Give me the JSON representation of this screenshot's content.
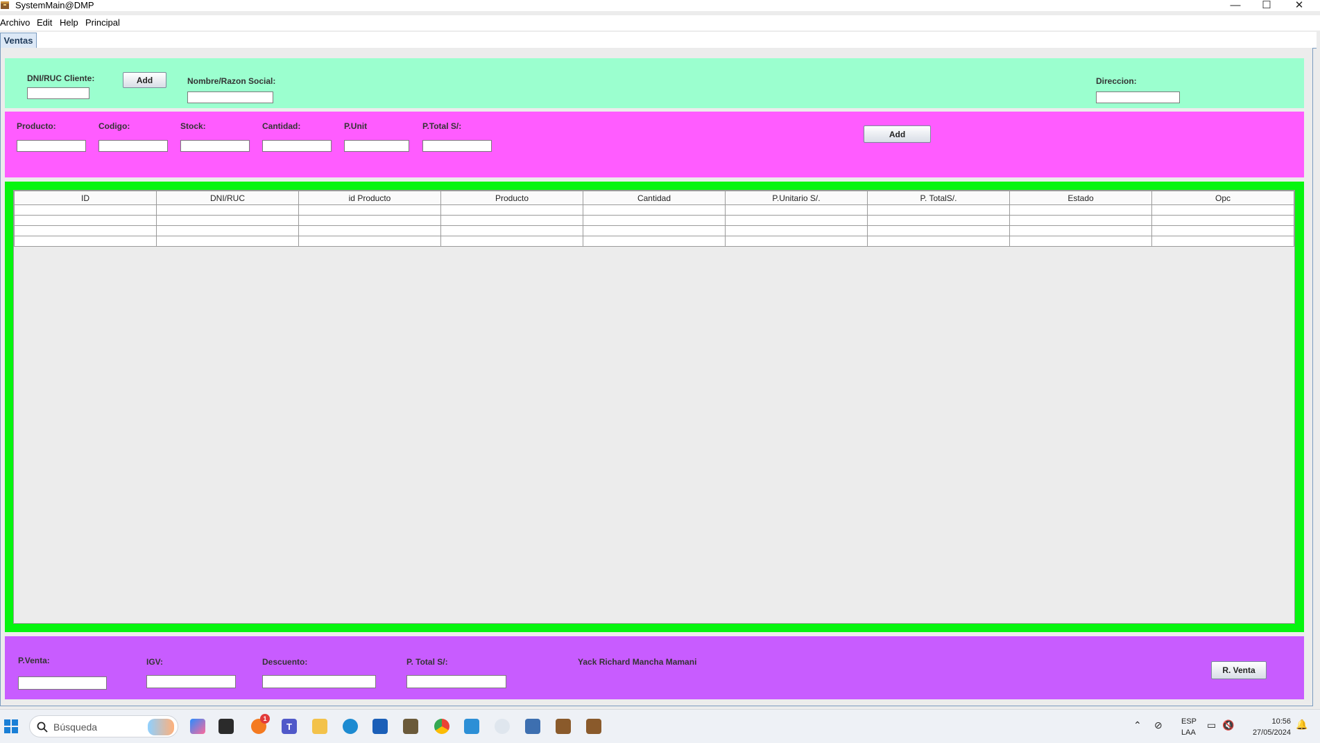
{
  "window": {
    "title": "SystemMain@DMP",
    "minimize_glyph": "—",
    "maximize_glyph": "☐",
    "close_glyph": "✕"
  },
  "menu": {
    "items": [
      "Archivo",
      "Edit",
      "Help",
      "Principal"
    ]
  },
  "tabs": [
    {
      "label": "Ventas",
      "selected": true
    }
  ],
  "client_panel": {
    "color": "#9bffcf",
    "dni_label": "DNI/RUC Cliente:",
    "dni_value": "",
    "add_label": "Add",
    "name_label": "Nombre/Razon Social:",
    "name_value": "",
    "address_label": "Direccion:",
    "address_value": ""
  },
  "product_panel": {
    "color": "#ff5cff",
    "product_label": "Producto:",
    "code_label": "Codigo:",
    "stock_label": "Stock:",
    "quantity_label": "Cantidad:",
    "unit_price_label": "P.Unit",
    "total_label": "P.Total S/:",
    "add_label": "Add"
  },
  "table": {
    "border_color": "#06f50f",
    "columns": [
      "ID",
      "DNI/RUC",
      "id Producto",
      "Producto",
      "Cantidad",
      "P.Unitario S/.",
      "P. TotalS/.",
      "Estado",
      "Opc"
    ],
    "rows": [
      [
        "",
        "",
        "",
        "",
        "",
        "",
        "",
        "",
        ""
      ],
      [
        "",
        "",
        "",
        "",
        "",
        "",
        "",
        "",
        ""
      ],
      [
        "",
        "",
        "",
        "",
        "",
        "",
        "",
        "",
        ""
      ],
      [
        "",
        "",
        "",
        "",
        "",
        "",
        "",
        "",
        ""
      ]
    ]
  },
  "totals_panel": {
    "color": "#c85cff",
    "sale_price_label": "P.Venta:",
    "igv_label": "IGV:",
    "discount_label": "Descuento:",
    "total_label": "P. Total S/:",
    "seller_name": "Yack Richard Mancha Mamani",
    "register_label": "R. Venta"
  },
  "taskbar": {
    "search_placeholder": "Búsqueda",
    "notification_badge": "1",
    "language_top": "ESP",
    "language_bottom": "LAA",
    "time": "10:56",
    "date": "27/05/2024"
  }
}
